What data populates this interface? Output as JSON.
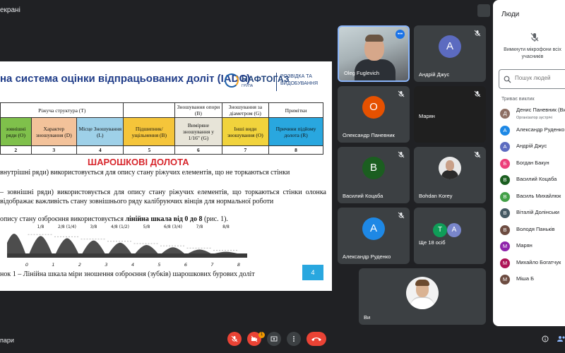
{
  "topbar": {
    "presenting_label": "екрані"
  },
  "slide": {
    "title": "на система оцінки відпрацьованих доліт (IADC)",
    "logo": {
      "brand": "НАФТОГАЗ",
      "brand_sub": "ГРУПА",
      "tag": "РОЗВІДКА ТА ВИДОБУВАННЯ"
    },
    "table": {
      "head": [
        "Ріжуча структура (Т)",
        "Зношування опори (В)",
        "Зношування за діаметром (G)",
        "Примітки"
      ],
      "sub": [
        "зовнішні ряди (O)",
        "Характер зношування (D)",
        "Місце Зношування (L)",
        "Підшипник/ущільнення (B)",
        "Виміряне зношування у 1/16\" (G)",
        "Інші види зношування (O)",
        "Причини підйому долота (R)"
      ],
      "nums": [
        "2",
        "3",
        "4",
        "5",
        "6",
        "7",
        "8"
      ]
    },
    "section_head": "ШАРОШКОВІ ДОЛОТА",
    "p1": "внутрішні ряди) використовується для опису стану ріжучих елементів, що не торкаються стінки",
    "p2": "– зовнішні ряди) використовується для опису стану ріжучих елементів, що торкаються стінки олонка відображає важливість стану зовнішнього ряду калібруючих вінців для нормальної роботи",
    "p3_pre": "опису стану озброєння використовується ",
    "p3_bold": "лінійна шкала від 0 до 8",
    "p3_post": " (рис. 1).",
    "scale_top": [
      "1/8",
      "2/8 (1/4)",
      "3/8",
      "4/8 (1/2)",
      "5/8",
      "6/8 (3/4)",
      "7/8",
      "8/8"
    ],
    "scale_bottom": [
      "0",
      "1",
      "2",
      "3",
      "4",
      "5",
      "6",
      "7",
      "8"
    ],
    "caption": "нок 1 –  Лінійна шкала міри зношення озброєння (зубків) шарошкових бурових доліт",
    "page_number": "4"
  },
  "tiles": [
    {
      "name": "Oleg Fuglevich"
    },
    {
      "name": "Андрій Джус",
      "initial": "А",
      "color": "#5c6bc0"
    },
    {
      "name": "Олександр Паневник",
      "initial": "О",
      "color": "#e65100"
    },
    {
      "name": "Марян"
    },
    {
      "name": "Василий Коцаба",
      "initial": "В",
      "color": "#1b5e20"
    },
    {
      "name": "Bohdan Korey"
    },
    {
      "name": "Александр Руденко",
      "initial": "А",
      "color": "#1e88e5"
    },
    {
      "name": "Ще 18 осіб",
      "initial_a": "Т",
      "initial_b": "А"
    },
    {
      "name": "Ви"
    }
  ],
  "panel": {
    "title": "Люди",
    "mute_text": "Вимкнути мікрофони всіх учасників",
    "search_placeholder": "Пошук людей",
    "section": "Триває виклик",
    "people": [
      {
        "name": "Денис Паневник (Ви)",
        "role": "Організатор зустрічі",
        "initial": "Д",
        "color": "#8d6e63"
      },
      {
        "name": "Александр Руденко",
        "initial": "А",
        "color": "#1e88e5"
      },
      {
        "name": "Андрій Джус",
        "initial": "А",
        "color": "#5c6bc0"
      },
      {
        "name": "Богдан Бакун",
        "initial": "Б",
        "color": "#ec407a"
      },
      {
        "name": "Василий Коцаба",
        "initial": "В",
        "color": "#1b5e20"
      },
      {
        "name": "Василь Михайлюк",
        "initial": "В",
        "color": "#43a047"
      },
      {
        "name": "Віталій Долінськи",
        "initial": "В",
        "color": "#455a64"
      },
      {
        "name": "Володя Паньків",
        "initial": "В",
        "color": "#6d4c41"
      },
      {
        "name": "Марян",
        "initial": "М",
        "color": "#8e24aa"
      },
      {
        "name": "Михайло Богатчук",
        "initial": "М",
        "color": "#ad1457"
      },
      {
        "name": "Міша Б",
        "initial": "М",
        "color": "#6d4c41"
      }
    ]
  },
  "bottom": {
    "meeting_title": "пари",
    "chat_badge": "1"
  }
}
